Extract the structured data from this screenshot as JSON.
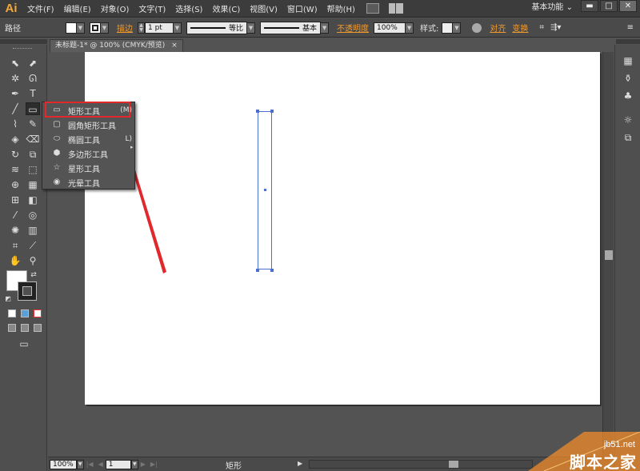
{
  "app": {
    "logo": "Ai",
    "workspace": "基本功能 ⌄"
  },
  "menu": [
    "文件(F)",
    "编辑(E)",
    "对象(O)",
    "文字(T)",
    "选择(S)",
    "效果(C)",
    "视图(V)",
    "窗口(W)",
    "帮助(H)"
  ],
  "window_buttons": {
    "minimize": "▬",
    "maximize": "□",
    "close": "✕"
  },
  "control_bar": {
    "label": "路径",
    "stroke_link": "描边",
    "stroke_weight": "1 pt",
    "profile_label": "等比",
    "brush_label": "基本",
    "opacity_link": "不透明度",
    "opacity_value": "100%",
    "style_label": "样式:",
    "align_link": "对齐",
    "transform_link": "变换"
  },
  "document_tab": {
    "title": "未标题-1* @ 100% (CMYK/预览)",
    "close": "×"
  },
  "flyout": {
    "items": [
      {
        "label": "矩形工具",
        "shortcut": "(M)",
        "icon": "rectangle-icon"
      },
      {
        "label": "圆角矩形工具",
        "shortcut": "",
        "icon": "rounded-rectangle-icon"
      },
      {
        "label": "椭圆工具",
        "shortcut": "L)",
        "icon": "ellipse-icon"
      },
      {
        "label": "多边形工具",
        "shortcut": "",
        "icon": "polygon-icon"
      },
      {
        "label": "星形工具",
        "shortcut": "",
        "icon": "star-icon"
      },
      {
        "label": "光晕工具",
        "shortcut": "",
        "icon": "flare-icon"
      }
    ]
  },
  "status_bar": {
    "zoom": "100%",
    "artboard": "1",
    "current_tool": "矩形"
  },
  "watermark": {
    "site": "jb51.net",
    "name": "脚本之家"
  },
  "colors": {
    "accent_orange": "#f19a2e",
    "highlight_red": "#e0282d",
    "selection_blue": "#4a6fd1",
    "logo_orange": "#f3a83b"
  }
}
